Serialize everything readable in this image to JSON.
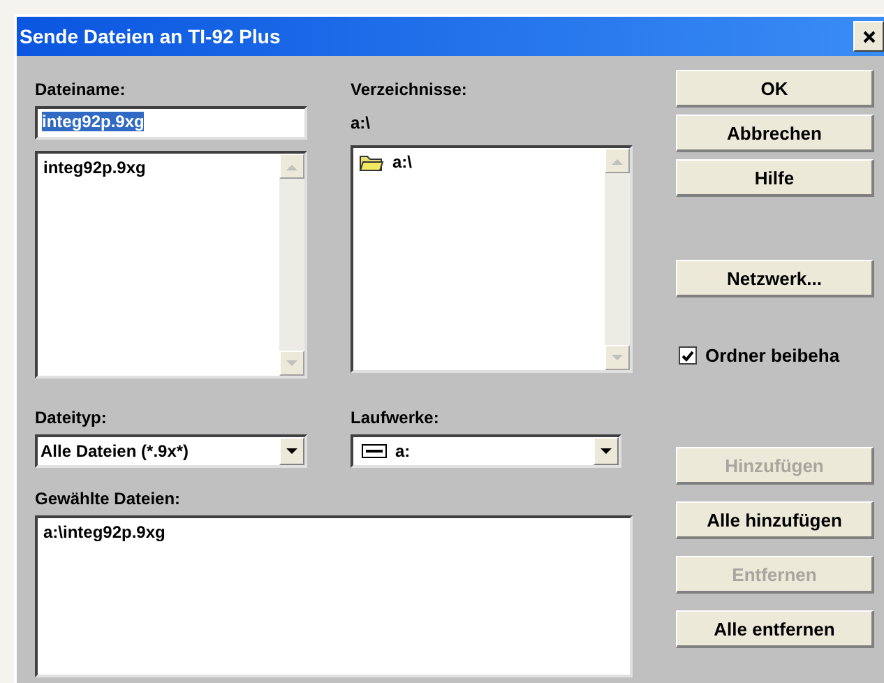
{
  "window": {
    "title": "Sende Dateien an TI-92 Plus"
  },
  "file_name": {
    "label": "Dateiname:",
    "value": "integ92p.9xg",
    "files": [
      "integ92p.9xg"
    ]
  },
  "directories": {
    "label": "Verzeichnisse:",
    "current": "a:\\",
    "items": [
      "a:\\"
    ]
  },
  "file_type": {
    "label": "Dateityp:",
    "value": "Alle Dateien (*.9x*)"
  },
  "drives": {
    "label": "Laufwerke:",
    "value": "a:"
  },
  "selected_files": {
    "label": "Gewählte Dateien:",
    "items": [
      "a:\\integ92p.9xg"
    ]
  },
  "top_buttons": [
    {
      "label": "OK",
      "disabled": false
    },
    {
      "label": "Abbrechen",
      "disabled": false
    },
    {
      "label": "Hilfe",
      "disabled": false
    }
  ],
  "network_button": {
    "label": "Netzwerk...",
    "disabled": false
  },
  "keep_folder": {
    "label": "Ordner beibeha",
    "checked": true
  },
  "bottom_buttons": [
    {
      "label": "Hinzufügen",
      "disabled": true
    },
    {
      "label": "Alle hinzufügen",
      "disabled": false
    },
    {
      "label": "Entfernen",
      "disabled": true
    },
    {
      "label": "Alle entfernen",
      "disabled": false
    }
  ]
}
